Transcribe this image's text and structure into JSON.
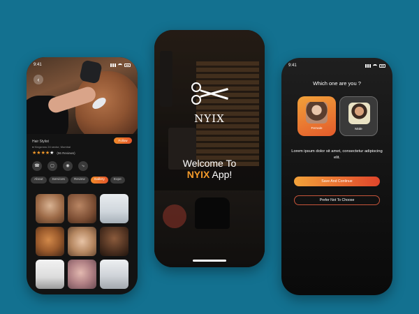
{
  "profile_screen": {
    "status_time": "9:41",
    "role": "Hair Stylist",
    "follow_label": "Follow",
    "address": "Kingcross 24 sector, Mumbai",
    "rating_stars": 4,
    "rating_max": 5,
    "reviews": "(96 Reviews)",
    "tabs": [
      "About",
      "Services",
      "Review",
      "Gallery",
      "Expe"
    ],
    "active_tab": "Gallery",
    "action_icons": [
      "phone-icon",
      "chat-icon",
      "location-pin-icon",
      "share-icon"
    ]
  },
  "welcome_screen": {
    "brand": "NYIX",
    "welcome_line1": "Welcome To",
    "welcome_accent": "NYIX",
    "welcome_suffix": " App!"
  },
  "gender_screen": {
    "status_time": "9:41",
    "question": "Which one are you ?",
    "options": [
      {
        "label": "Female",
        "selected": true
      },
      {
        "label": "Male",
        "selected": false
      }
    ],
    "description": "Lorem ipsum dolor sit amet, consectetur adipiscing elit.",
    "primary_button": "Save And Continue",
    "secondary_button": "Prefer Not To Choose"
  },
  "colors": {
    "background": "#137190",
    "accent_orange": "#f39a2b",
    "accent_red": "#e0452b"
  }
}
